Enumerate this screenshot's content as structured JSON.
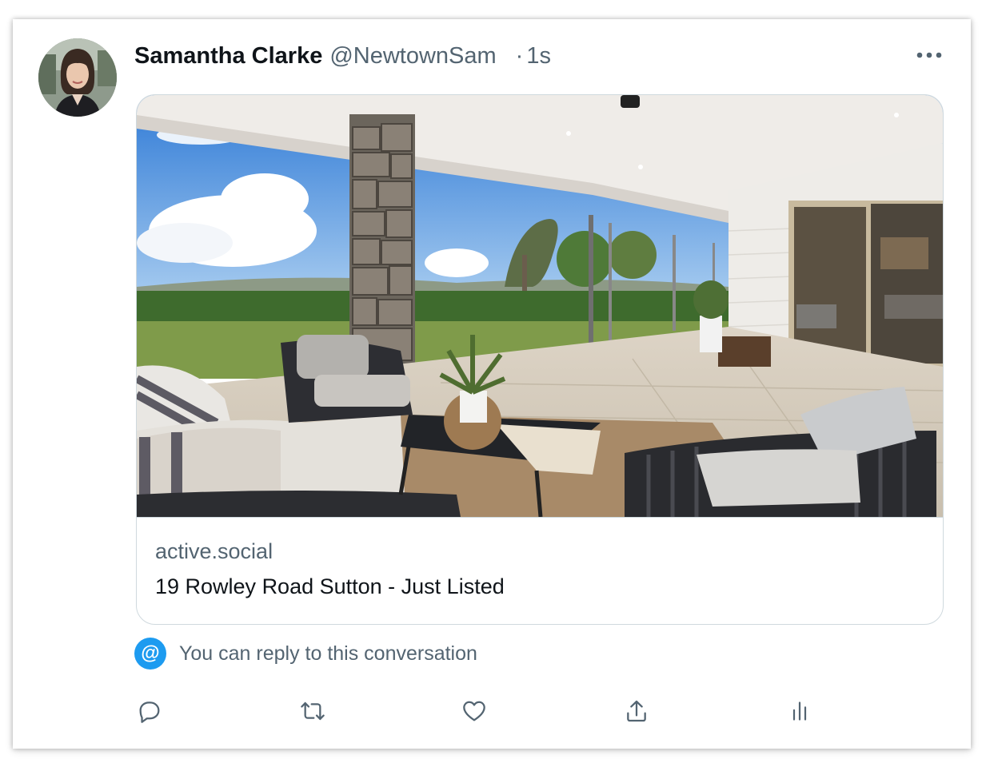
{
  "tweet": {
    "author_name": "Samantha Clarke",
    "author_handle": "@NewtownSam",
    "separator": "·",
    "timestamp": "1s"
  },
  "link_card": {
    "domain": "active.social",
    "title": "19 Rowley Road Sutton - Just Listed"
  },
  "reply_notice": {
    "badge": "@",
    "text": "You can reply to this conversation"
  },
  "icons": {
    "more": "more-options-icon",
    "reply": "reply-icon",
    "retweet": "retweet-icon",
    "like": "heart-icon",
    "share": "share-icon",
    "analytics": "analytics-icon"
  },
  "colors": {
    "text_primary": "#0f1419",
    "text_secondary": "#536471",
    "accent": "#1d9bf0",
    "border": "#cfd9de"
  }
}
